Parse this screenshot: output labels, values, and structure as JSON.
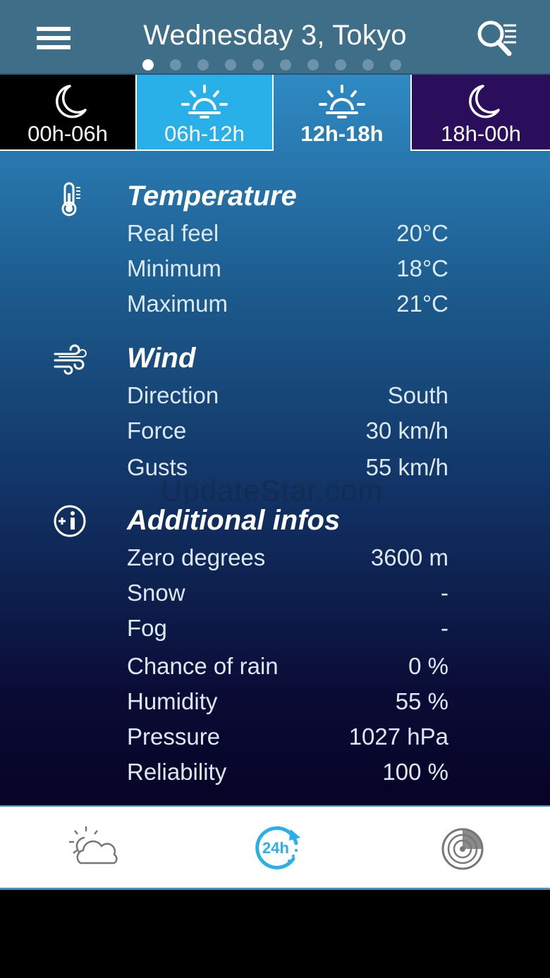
{
  "header": {
    "title": "Wednesday 3, Tokyo",
    "menu_icon": "hamburger-menu-icon",
    "search_icon": "search-list-icon",
    "page_dots": {
      "count": 10,
      "active_index": 0
    }
  },
  "tabs": [
    {
      "label": "00h-06h",
      "icon": "moon-icon",
      "bg": "#000000",
      "selected": false
    },
    {
      "label": "06h-12h",
      "icon": "sunrise-icon",
      "bg": "#2ab0e8",
      "selected": false
    },
    {
      "label": "12h-18h",
      "icon": "sun-icon",
      "bg": "#2f8ac4",
      "selected": true
    },
    {
      "label": "18h-00h",
      "icon": "moon-icon",
      "bg": "#2a0e5c",
      "selected": false
    }
  ],
  "temperature": {
    "title": "Temperature",
    "icon": "thermometer-icon",
    "rows": [
      {
        "label": "Real feel",
        "value": "20°C"
      },
      {
        "label": "Minimum",
        "value": "18°C"
      },
      {
        "label": "Maximum",
        "value": "21°C"
      }
    ]
  },
  "wind": {
    "title": "Wind",
    "icon": "wind-icon",
    "rows": [
      {
        "label": "Direction",
        "value": "South"
      },
      {
        "label": "Force",
        "value": "30 km/h"
      },
      {
        "label": "Gusts",
        "value": "55 km/h"
      }
    ]
  },
  "additional": {
    "title": "Additional infos",
    "icon": "info-plus-icon",
    "rows": [
      {
        "label": "Zero degrees",
        "value": "3600 m"
      },
      {
        "label": "Snow",
        "value": "-"
      },
      {
        "label": "Fog",
        "value": "-"
      },
      {
        "label": "Chance of rain",
        "value": "0 %"
      },
      {
        "label": "Humidity",
        "value": "55 %"
      },
      {
        "label": "Pressure",
        "value": "1027 hPa"
      },
      {
        "label": "Reliability",
        "value": "100 %"
      }
    ]
  },
  "watermark": "UpdateStar.com",
  "bottom_nav": [
    {
      "name": "forecast",
      "icon": "sun-cloud-icon",
      "active": false
    },
    {
      "name": "24h",
      "icon": "24h-icon",
      "label": "24h",
      "active": true
    },
    {
      "name": "radar",
      "icon": "radar-icon",
      "active": false
    }
  ],
  "colors": {
    "accent": "#2ab0e8",
    "header_bg": "#3f6e89",
    "night_tab": "#2a0e5c"
  }
}
